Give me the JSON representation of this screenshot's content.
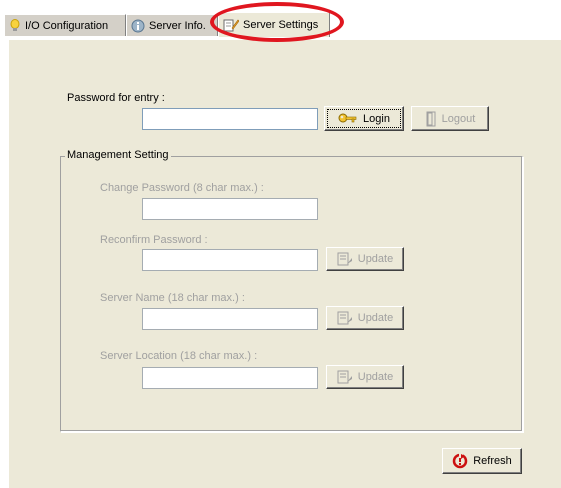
{
  "tabs": [
    {
      "label": "I/O Configuration",
      "icon": "lightbulb-icon",
      "active": false
    },
    {
      "label": "Server Info.",
      "icon": "info-icon",
      "active": false
    },
    {
      "label": "Server Settings",
      "icon": "settings-pencil-icon",
      "active": true
    }
  ],
  "login": {
    "password_label": "Password for entry :",
    "password_value": "",
    "login_button": "Login",
    "logout_button": "Logout"
  },
  "management": {
    "group_title": "Management Setting",
    "change_password_label": "Change Password (8 char max.) :",
    "reconfirm_password_label": "Reconfirm Password :",
    "server_name_label": "Server Name (18 char max.) :",
    "server_location_label": "Server Location (18 char max.) :",
    "update_button": "Update"
  },
  "refresh_button": "Refresh",
  "colors": {
    "panel": "#ece9d8",
    "highlight": "#e0161f",
    "disabled_text": "#a0a0a0"
  }
}
